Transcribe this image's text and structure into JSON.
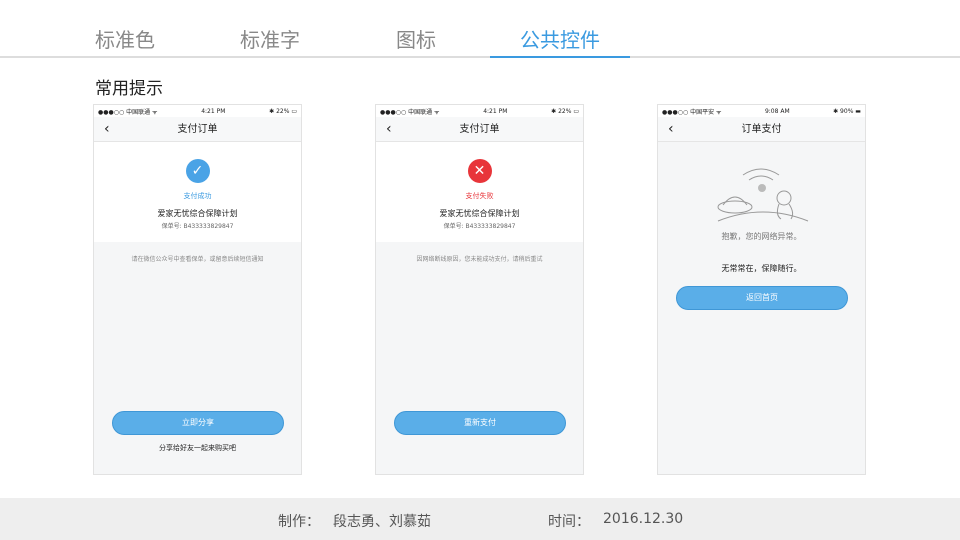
{
  "tabs": [
    {
      "label": "标准色"
    },
    {
      "label": "标准字"
    },
    {
      "label": "图标"
    },
    {
      "label": "公共控件"
    }
  ],
  "section_title": "常用提示",
  "phones": [
    {
      "carrier": "●●●○○ 中国联通 ᯤ",
      "time": "4:21 PM",
      "battery": "✱ 22% ▭",
      "title": "支付订单",
      "status": "支付成功",
      "status_color": "#3a9ae0",
      "plan": "爱家无忧综合保障计划",
      "policy_no": "保单号: B433333829847",
      "hint": "请在微信公众号中查看保单，或留意后续短信通知",
      "button": "立即分享",
      "sub": "分享给好友一起来购买吧"
    },
    {
      "carrier": "●●●○○ 中国联通 ᯤ",
      "time": "4:21 PM",
      "battery": "✱ 22% ▭",
      "title": "支付订单",
      "status": "支付失败",
      "status_color": "#e8353a",
      "plan": "爱家无忧综合保障计划",
      "policy_no": "保单号: B433333829847",
      "hint": "因网络断线原因，您未能成功支付，请稍后重试",
      "button": "重新支付"
    },
    {
      "carrier": "●●●○○ 中国平安 ᯤ",
      "time": "9:08 AM",
      "battery": "✱ 90% ▬",
      "title": "订单支付",
      "error": "抱歉，您的网络异常。",
      "slogan": "无常常在，保障随行。",
      "button": "返回首页"
    }
  ],
  "footer": {
    "author_label": "制作：",
    "authors": "段志勇、刘慕茹",
    "time_label": "时间：",
    "date": "2016.12.30"
  }
}
